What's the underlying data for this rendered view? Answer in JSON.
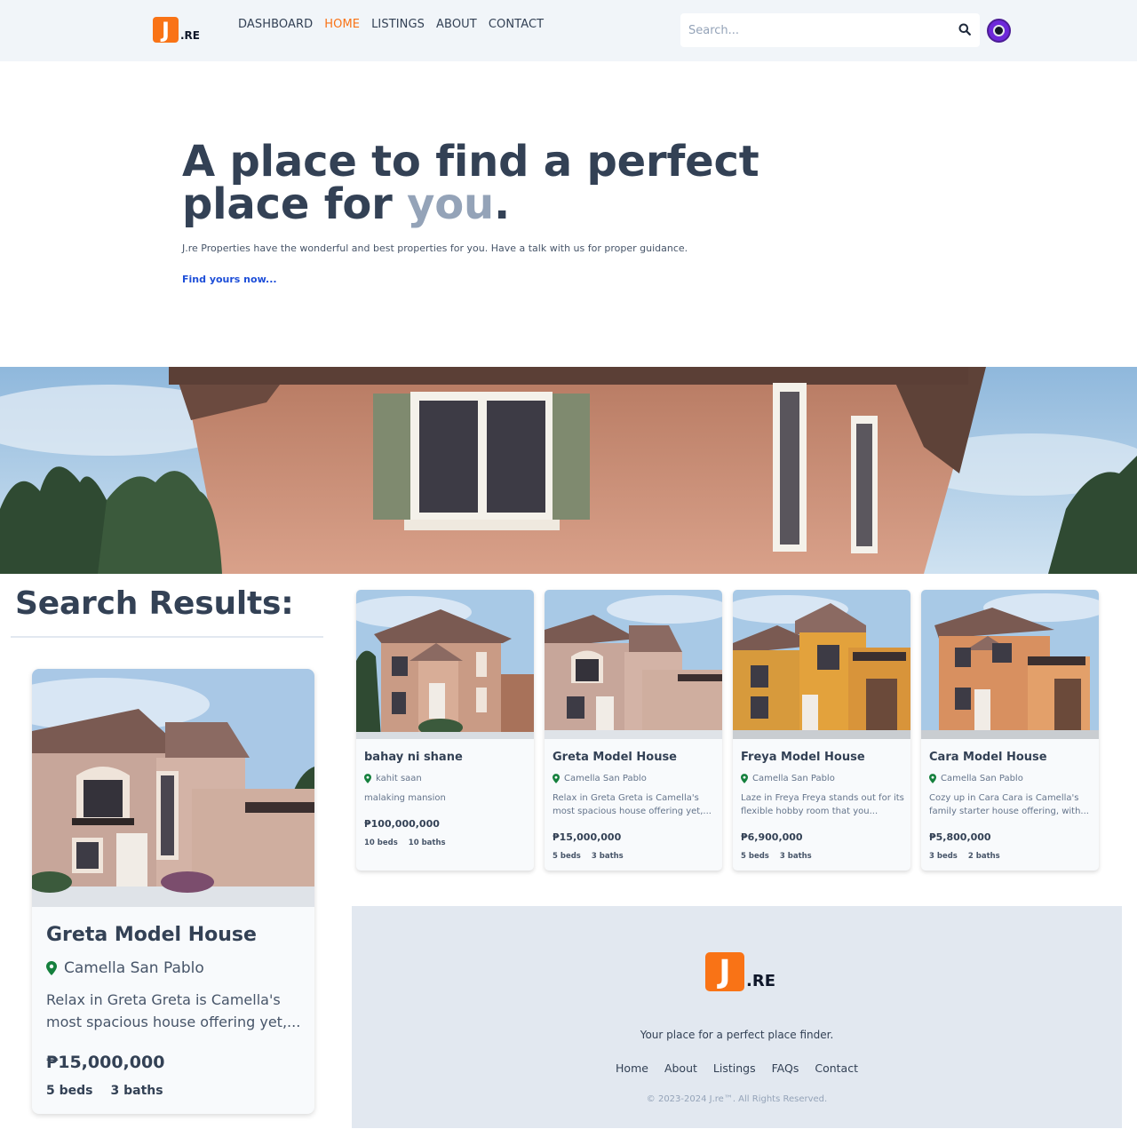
{
  "brand": {
    "logo_letter": "J",
    "logo_suffix": ".RE",
    "color": "#f97316"
  },
  "nav": [
    {
      "label": "DASHBOARD",
      "active": false
    },
    {
      "label": "HOME",
      "active": true
    },
    {
      "label": "LISTINGS",
      "active": false
    },
    {
      "label": "ABOUT",
      "active": false
    },
    {
      "label": "CONTACT",
      "active": false
    }
  ],
  "search": {
    "placeholder": "Search...",
    "icon": "search-icon"
  },
  "hero": {
    "title_part1": "A place to find a perfect",
    "title_part2": "place for ",
    "title_accent": "you",
    "title_end": ".",
    "subtitle": "J.re Properties have the wonderful and best properties for you. Have a talk with us for proper guidance.",
    "cta": "Find yours now..."
  },
  "results": {
    "title": "Search Results:",
    "featured": {
      "title": "Greta Model House",
      "location": "Camella San Pablo",
      "description": "Relax in Greta Greta is Camella's most spacious house offering yet,...",
      "price": "₱15,000,000",
      "beds": "5 beds",
      "baths": "3 baths"
    },
    "cards": [
      {
        "title": "bahay ni shane",
        "location": "kahit saan",
        "description": "malaking mansion",
        "price": "₱100,000,000",
        "beds": "10 beds",
        "baths": "10 baths"
      },
      {
        "title": "Greta Model House",
        "location": "Camella San Pablo",
        "description": "Relax in Greta Greta is Camella's most spacious house offering yet,...",
        "price": "₱15,000,000",
        "beds": "5 beds",
        "baths": "3 baths"
      },
      {
        "title": "Freya Model House",
        "location": "Camella San Pablo",
        "description": "Laze in Freya Freya stands out for its flexible hobby room that you...",
        "price": "₱6,900,000",
        "beds": "5 beds",
        "baths": "3 baths"
      },
      {
        "title": "Cara Model House",
        "location": "Camella San Pablo",
        "description": "Cozy up in Cara Cara is Camella's family starter house offering, with...",
        "price": "₱5,800,000",
        "beds": "3 beds",
        "baths": "2 baths"
      }
    ]
  },
  "footer": {
    "tagline": "Your place for a perfect place finder.",
    "links": [
      "Home",
      "About",
      "Listings",
      "FAQs",
      "Contact"
    ],
    "copyright": "© 2023-2024 J.re™. All Rights Reserved."
  }
}
